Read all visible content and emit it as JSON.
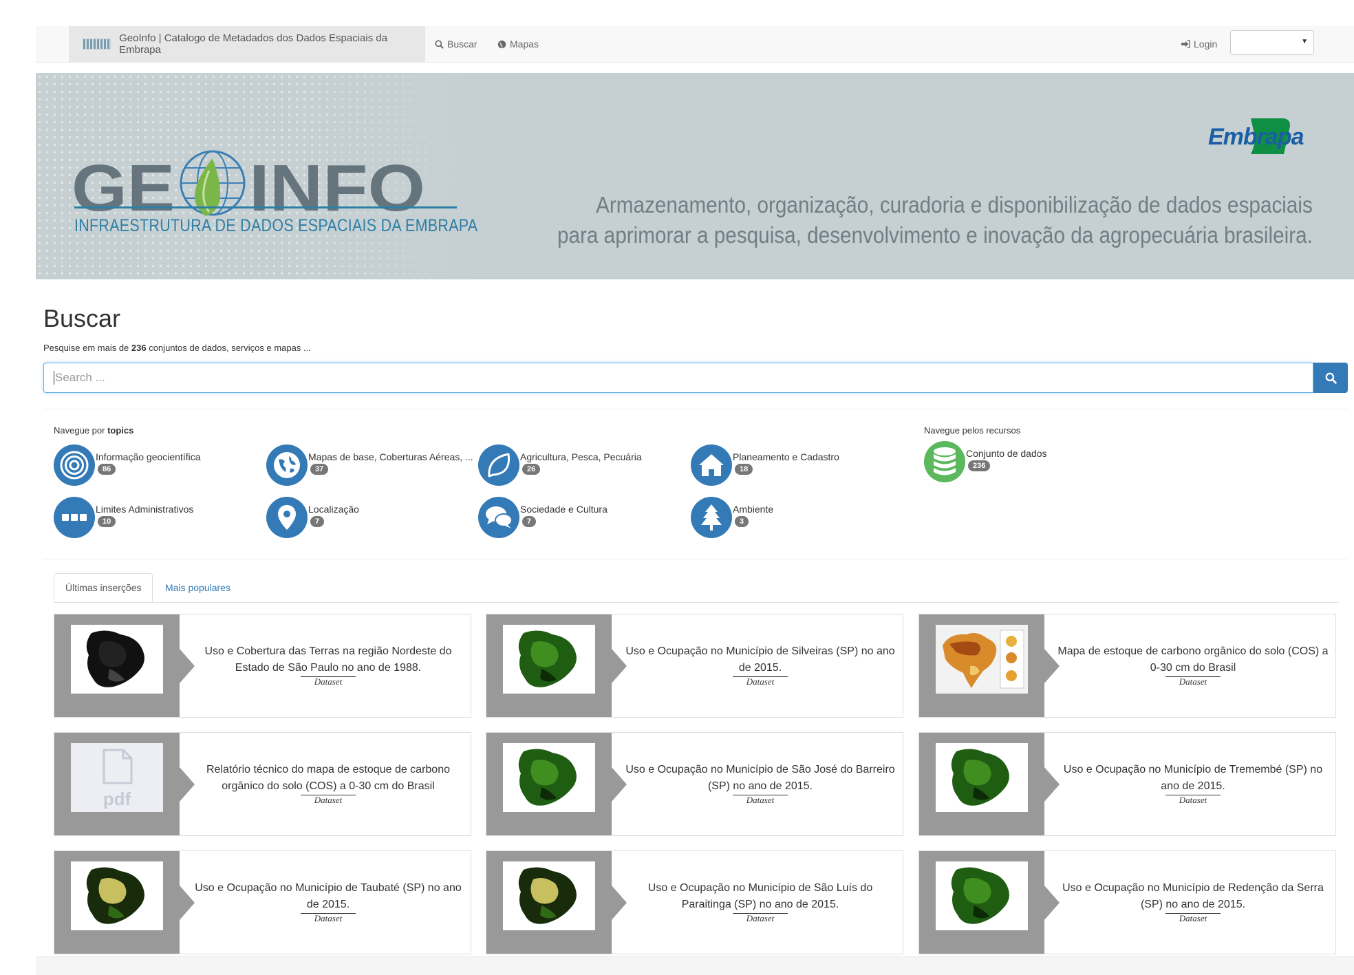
{
  "navbar": {
    "brand": "GeoInfo | Catalogo de Metadados dos Dados Espaciais da Embrapa",
    "buscar": "Buscar",
    "mapas": "Mapas",
    "login": "Login"
  },
  "banner": {
    "logo_text": "GEOINFO",
    "logo_subtitle": "INFRAESTRUTURA DE DADOS ESPACIAIS DA EMBRAPA",
    "partner_logo": "Embrapa",
    "tagline_line1": "Armazenamento, organização, curadoria e disponibilização de dados espaciais",
    "tagline_line2": "para aprimorar a pesquisa, desenvolvimento e inovação da agropecuária brasileira."
  },
  "search": {
    "title": "Buscar",
    "subtitle_pre": "Pesquise em mais de ",
    "count": "236",
    "subtitle_post": " conjuntos de dados, serviços e mapas ...",
    "placeholder": "Search ..."
  },
  "topics": {
    "label_pre": "Navegue por ",
    "label_bold": "topics",
    "items": [
      {
        "label": "Informação geocientífica",
        "count": "86",
        "icon": "target-icon"
      },
      {
        "label": "Mapas de base, Coberturas Aéreas, ...",
        "count": "37",
        "icon": "globe-icon"
      },
      {
        "label": "Agricultura, Pesca, Pecuária",
        "count": "26",
        "icon": "leaf-icon"
      },
      {
        "label": "Planeamento e Cadastro",
        "count": "18",
        "icon": "home-icon"
      },
      {
        "label": "Limites Administrativos",
        "count": "10",
        "icon": "dots-icon"
      },
      {
        "label": "Localização",
        "count": "7",
        "icon": "map-pin-icon"
      },
      {
        "label": "Sociedade e Cultura",
        "count": "7",
        "icon": "chat-bubbles-icon"
      },
      {
        "label": "Ambiente",
        "count": "3",
        "icon": "tree-icon"
      }
    ]
  },
  "resources": {
    "label": "Navegue pelos recursos",
    "items": [
      {
        "label": "Conjunto de dados",
        "count": "236",
        "icon": "database-icon",
        "color": "#5cb85c"
      }
    ]
  },
  "tabs": [
    {
      "label": "Últimas inserções",
      "active": true
    },
    {
      "label": "Mais populares",
      "active": false
    }
  ],
  "cards": [
    {
      "title": "Uso e Cobertura das Terras na região Nordeste do Estado de São Paulo no ano de 1988.",
      "type": "Dataset",
      "thumb": "dark-map"
    },
    {
      "title": "Uso e Ocupação no Município de Silveiras (SP) no ano de 2015.",
      "type": "Dataset",
      "thumb": "green-map"
    },
    {
      "title": "Mapa de estoque de carbono orgânico do solo (COS) a 0-30 cm do Brasil",
      "type": "Dataset",
      "thumb": "brazil-map"
    },
    {
      "title": "Relatório técnico do mapa de estoque de carbono orgânico do solo (COS) a 0-30 cm do Brasil",
      "type": "Dataset",
      "thumb": "pdf"
    },
    {
      "title": "Uso e Ocupação no Município de São José do Barreiro (SP) no ano de 2015.",
      "type": "Dataset",
      "thumb": "green-map"
    },
    {
      "title": "Uso e Ocupação no Município de Tremembé (SP) no ano de 2015.",
      "type": "Dataset",
      "thumb": "green-map"
    },
    {
      "title": "Uso e Ocupação no Município de Taubaté (SP) no ano de 2015.",
      "type": "Dataset",
      "thumb": "yellow-map"
    },
    {
      "title": "Uso e Ocupação no Município de São Luís do Paraitinga (SP) no ano de 2015.",
      "type": "Dataset",
      "thumb": "yellow-map"
    },
    {
      "title": "Uso e Ocupação no Município de Redenção da Serra (SP) no ano de 2015.",
      "type": "Dataset",
      "thumb": "green-map"
    }
  ],
  "colors": {
    "primary": "#337ab7",
    "badge": "#777777",
    "card_side": "#999999",
    "banner_bg": "#c6cfd1"
  }
}
